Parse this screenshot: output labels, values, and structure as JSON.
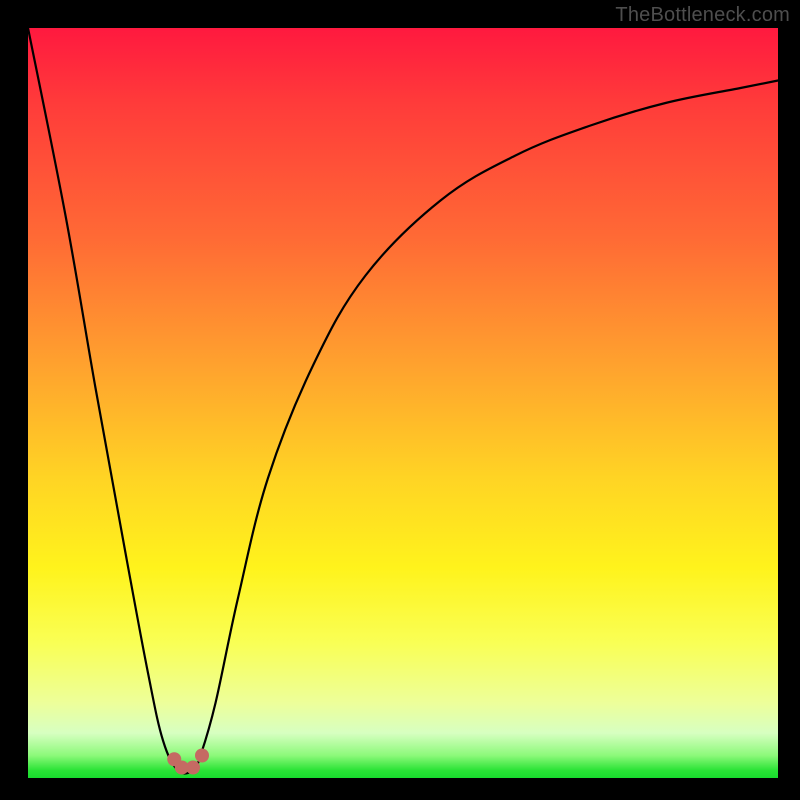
{
  "watermark": {
    "text": "TheBottleneck.com"
  },
  "chart_data": {
    "type": "line",
    "title": "",
    "xlabel": "",
    "ylabel": "",
    "ylim": [
      0,
      100
    ],
    "xlim": [
      0,
      100
    ],
    "series": [
      {
        "name": "bottleneck-curve",
        "x": [
          0,
          5,
          9,
          13,
          16,
          18,
          20,
          22,
          23,
          25,
          28,
          32,
          38,
          45,
          55,
          65,
          75,
          85,
          95,
          100
        ],
        "values": [
          100,
          75,
          52,
          30,
          14,
          5,
          1,
          1,
          3,
          10,
          24,
          40,
          55,
          67,
          77,
          83,
          87,
          90,
          92,
          93
        ]
      }
    ],
    "markers": [
      {
        "name": "min-marker-left",
        "x": 19.5,
        "y": 2.5
      },
      {
        "name": "min-marker-mid-l",
        "x": 20.5,
        "y": 1.4
      },
      {
        "name": "min-marker-mid-r",
        "x": 22.0,
        "y": 1.4
      },
      {
        "name": "min-marker-right",
        "x": 23.2,
        "y": 3.0
      }
    ],
    "colors": {
      "curve": "#000000",
      "marker": "#c56a63",
      "gradient_top": "#ff193f",
      "gradient_bottom": "#18db2e"
    }
  }
}
